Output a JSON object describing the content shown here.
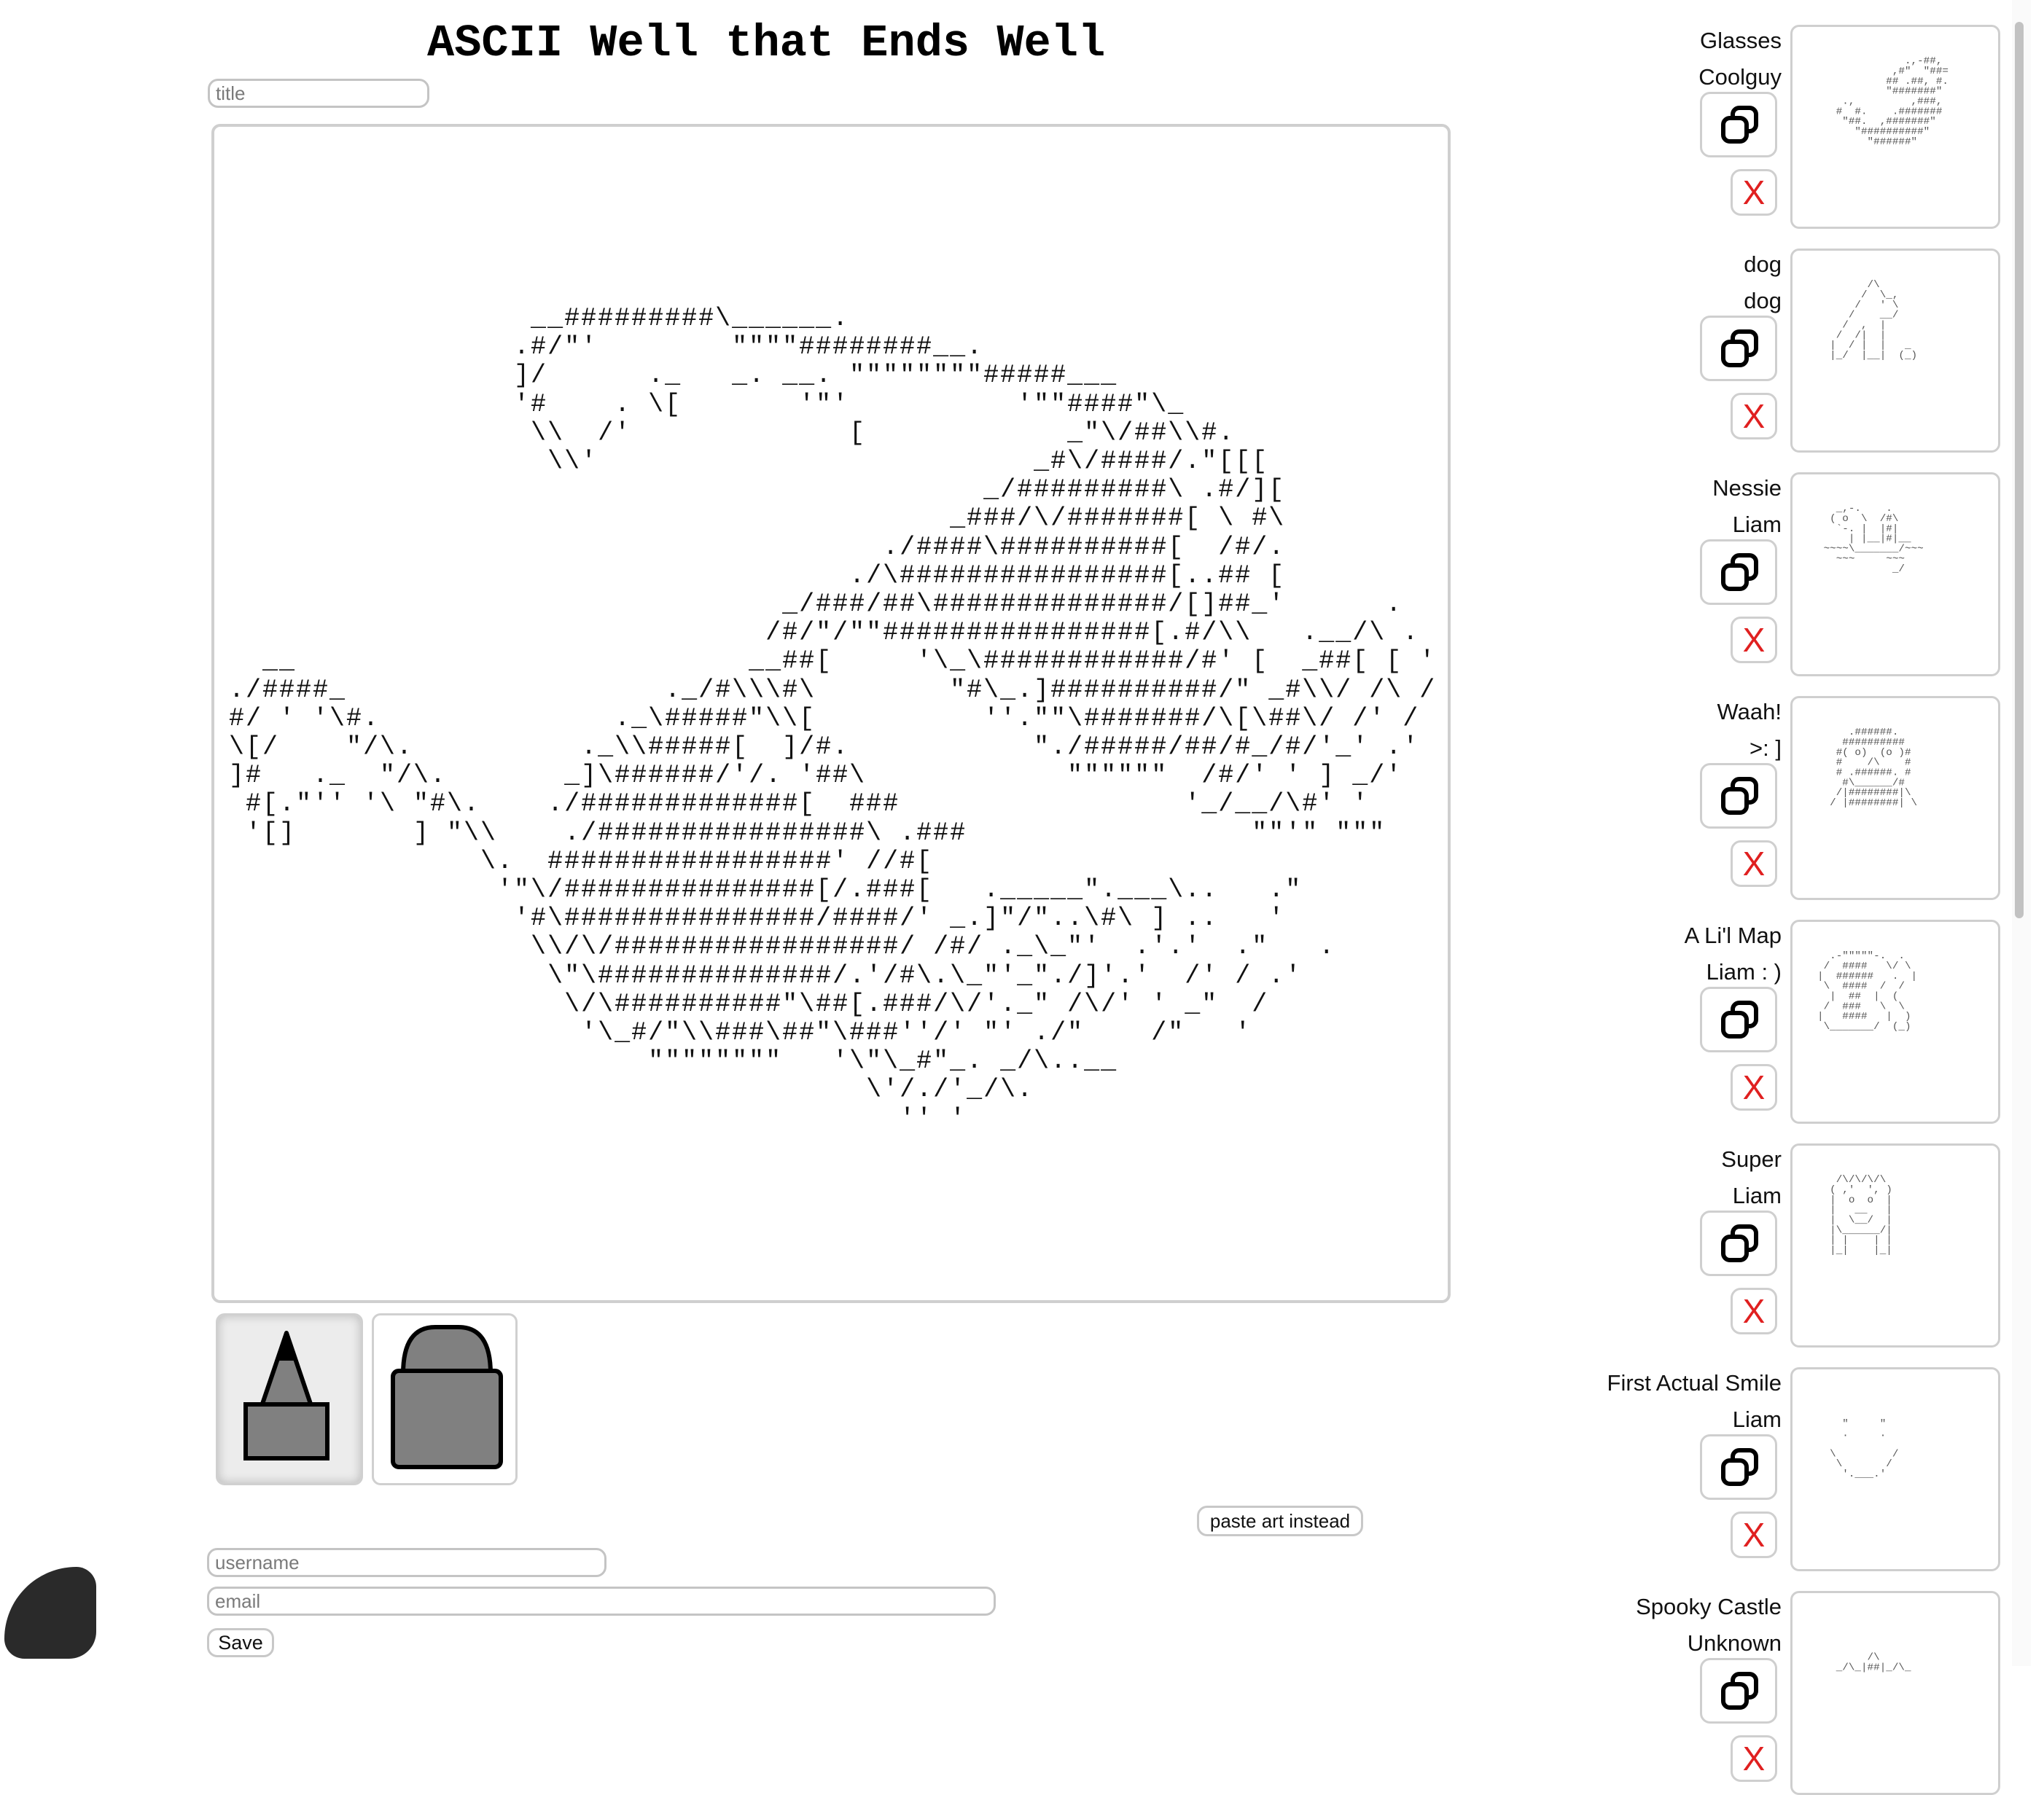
{
  "header": {
    "title": "ASCII Well that Ends Well"
  },
  "form": {
    "title_placeholder": "title",
    "username_placeholder": "username",
    "email_placeholder": "email",
    "save_label": "Save",
    "paste_label": "paste art instead"
  },
  "canvas": {
    "art": "                  __#########\\______.\n                 .#/\"'        \"\"\"\"########__.\n                 ]/      ._   _. __. \"\"\"\"\"\"\"\"#####___\n                 '#    . \\[       '\"'          '\"\"####\"\\_\n                  \\\\  /'             [            _\"\\/##\\\\#.\n                   \\\\'                          _#\\/####/.\"[[[\n                                             _/#########\\ .#/][\n                                           _###/\\/#######[ \\ #\\\n                                       ./####\\##########[  /#/.\n                                     ./\\################[..## [\n                                 _/###/##\\##############/[]##_'      .\n                                /#/\"/\"\"################[.#/\\\\   .__/\\ .\n  __                           __##[     '\\_\\############/#' [  _##[ [ '\n./####_                   ._/#\\\\\\#\\        \"#\\_.]##########/\" _#\\\\/ /\\ /\n#/ ' '\\#.              ._\\#####\"\\\\[          ''.\"\"\\#######/\\[\\##\\/ /' /\n\\[/    \"/\\.          ._\\\\#####[  ]/#.           \"./#####/##/#_/#/'_' .'\n]#   ._  \"/\\.       _]\\######/'/. '##\\            \"\"\"\"\"\"  /#/' ' ] _/'\n #[.\"'' '\\ \"#\\.    ./#############[  ###                 '_/__/\\#' '\n '[]       ] \"\\\\    ./################\\ .###                 \"\"'\" \"\"\"\n               \\.  #################' //#[\n                '\"\\/###############[/.###[   ._____\".___\\..   .\"\n                 '#\\###############/####/' _.]\"/\"..\\#\\ ] ..   '\n                  \\\\/\\/#################/ /#/ ._\\_\"'  .'.'  .\"   .\n                   \\\"\\##############/.'/#\\.\\_\"'_\"./]'.'  /' / .'\n                    \\/\\##########\"\\##[.###/\\/'._\" /\\/' ' _\"  /\n                     '\\_#/\"\\\\###\\##\"\\###''/' \"' ./\"    /\"   '\n                         \"\"\"\"\"\"\"\"   '\\\"\\_#\"_. _/\\..__\n                                      \\'/./'_/\\.\n                                        '' '"
  },
  "tools": [
    {
      "name": "pencil",
      "active": true
    },
    {
      "name": "eraser",
      "active": false
    }
  ],
  "gallery": [
    {
      "title": "Glasses",
      "author": "Coolguy",
      "copy_icon": "copy-icon",
      "delete_label": "X",
      "thumb": "              .,-##,\n            ,#\"  \"##=\n           ## .##, #.\n           \"#######\"\n    .,         ,###,\n   #  #.    .#######\n    \"##.  ,#######\"\n      \"##########\"\n        \"######\""
    },
    {
      "title": "dog",
      "author": "dog",
      "copy_icon": "copy-icon",
      "delete_label": "X",
      "thumb": "        /\\\n       /  \\_,\n      /   ' \\\n     /    __/\n    /  ,  |\n   /  /|  |\n  |  / |  |   _\n  |_/  |__|  (_)"
    },
    {
      "title": "Nessie",
      "author": "Liam",
      "copy_icon": "copy-icon",
      "delete_label": "X",
      "thumb": "   _,-.    .\n  ( o  \\  /#\\\n   `-. |  |#|\n     | |__|#|__\n ~~~~\\_______/~~~\n   ~~~     ~~~\n            _/"
    },
    {
      "title": "Waah!",
      "author": ">: ]",
      "copy_icon": "copy-icon",
      "delete_label": "X",
      "thumb": "     .######.\n    ##########\n   #( o)  (o )#\n   #    /\\    #\n   # .######. #\n    #\\______/#\n   /|########|\\\n  / |########| \\"
    },
    {
      "title": "A Li'l Map",
      "author": "Liam : )",
      "copy_icon": "copy-icon",
      "delete_label": "X",
      "thumb": "  .-\"\"\"\"\"-.  .\n /  ####   \\/ \\\n|  ######   .  |\n \\  ####  /  /\n  |  ##  |  (\n /  ###   \\  \\\n|   ####   |  )\n \\_______/  (_)"
    },
    {
      "title": "Super",
      "author": "Liam",
      "copy_icon": "copy-icon",
      "delete_label": "X",
      "thumb": "   /\\/\\/\\/\\\n  ( ,'  ', )\n  |  o  o  |\n  |   __   |\n  |  \\__/  |\n  |\\______/|\n  | |    | |\n  |_|    |_|"
    },
    {
      "title": "First Actual Smile",
      "author": "Liam",
      "copy_icon": "copy-icon",
      "delete_label": "X",
      "thumb": "\n\n    \"     \"\n    .     .\n\n  \\         /\n   \\       /\n    '.___.'"
    },
    {
      "title": "Spooky Castle",
      "author": "Unknown",
      "copy_icon": "copy-icon",
      "delete_label": "X",
      "thumb": "\n\n\n        /\\\n   _/\\_|##|_/\\_"
    }
  ]
}
